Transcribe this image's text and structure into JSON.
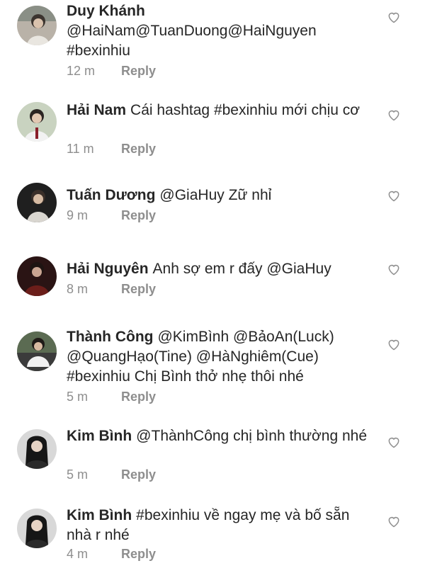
{
  "comments": [
    {
      "user": "Duy Khánh",
      "text": "@HaiNam@TuanDuong@HaiNguyen #bexinhiu",
      "time": "12 m",
      "reply": "Reply"
    },
    {
      "user": "Hải Nam",
      "text": "Cái hashtag #bexinhiu mới chịu cơ",
      "time": "11 m",
      "reply": "Reply"
    },
    {
      "user": "Tuấn Dương",
      "text": "@GiaHuy Zữ nhỉ",
      "time": "9 m",
      "reply": "Reply"
    },
    {
      "user": "Hải Nguyên",
      "text": "Anh sợ em r đấy @GiaHuy",
      "time": "8 m",
      "reply": "Reply"
    },
    {
      "user": "Thành Công",
      "text": "@KimBình @BảoAn(Luck) @QuangHạo(Tine) @HàNghiêm(Cue) #bexinhiu Chị Bình thở nhẹ thôi nhé",
      "time": "5 m",
      "reply": "Reply"
    },
    {
      "user": "Kim Bình",
      "text": "@ThànhCông chị bình thường nhé",
      "time": "5 m",
      "reply": "Reply"
    },
    {
      "user": "Kim Bình",
      "text": "#bexinhiu về ngay mẹ và bố sẵn nhà r nhé",
      "time": "4 m",
      "reply": "Reply"
    }
  ],
  "icons": {
    "like": "heart-outline-icon",
    "avatar": "avatar-photo"
  },
  "colors": {
    "text": "#262626",
    "muted": "#8e8e8e",
    "background": "#ffffff"
  }
}
